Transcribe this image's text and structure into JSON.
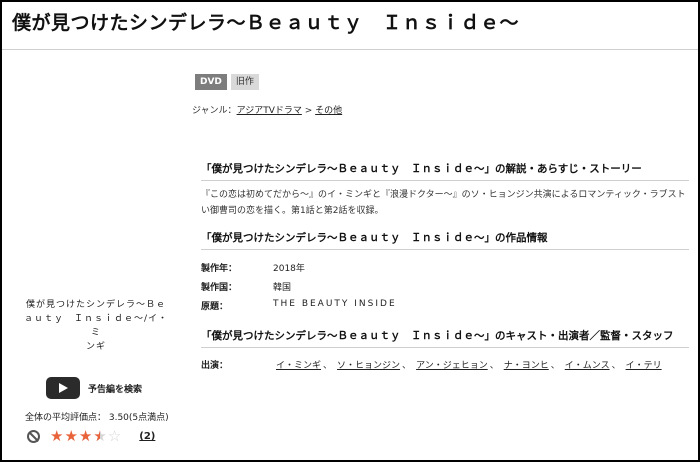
{
  "title": "僕が見つけたシンデレラ〜Ｂｅａｕｔｙ　Ｉｎｓｉｄｅ〜",
  "badges": {
    "dvd": "DVD",
    "old": "旧作"
  },
  "genre": {
    "label": "ジャンル：",
    "primary": "アジアTVドラマ",
    "arrow": ">",
    "secondary": "その他"
  },
  "story_section": {
    "heading": "「僕が見つけたシンデレラ〜Ｂｅａｕｔｙ　Ｉｎｓｉｄｅ〜」の解説・あらすじ・ストーリー",
    "line1": "『この恋は初めてだから〜』のイ・ミンギと『浪漫ドクター〜』のソ・ヒョンジン共演によるロマンティック・ラブスト",
    "line2": "い御曹司の恋を描く。第1話と第2話を収録。"
  },
  "info_section": {
    "heading": "「僕が見つけたシンデレラ〜Ｂｅａｕｔｙ　Ｉｎｓｉｄｅ〜」の作品情報",
    "rows": [
      {
        "key": "製作年：",
        "value": "2018年"
      },
      {
        "key": "製作国：",
        "value": "韓国"
      },
      {
        "key": "原題：",
        "value": "THE BEAUTY INSIDE"
      }
    ]
  },
  "cast_section": {
    "heading": "「僕が見つけたシンデレラ〜Ｂｅａｕｔｙ　Ｉｎｓｉｄｅ〜」のキャスト・出演者／監督・スタッフ",
    "label": "出演：",
    "members": [
      "イ・ミンギ",
      "ソ・ヒョンジン",
      "アン・ジェヒョン",
      "ナ・ヨンヒ",
      "イ・ムンス",
      "イ・テリ"
    ],
    "separator": "、"
  },
  "sidebar": {
    "title_line1": "僕が見つけたシンデレラ〜Ｂｅ",
    "title_line2": "ａｕｔｙ　Ｉｎｓｉｄｅ〜/イ・ミ",
    "title_line3": "ンギ",
    "trailer_label": "予告編を検索",
    "avg_rating": "全体の平均評価点： 3.50(5点満点)",
    "rating_value": 3.5,
    "rating_max": 5,
    "review_count": "(2)",
    "star_color": "#e8623a"
  }
}
